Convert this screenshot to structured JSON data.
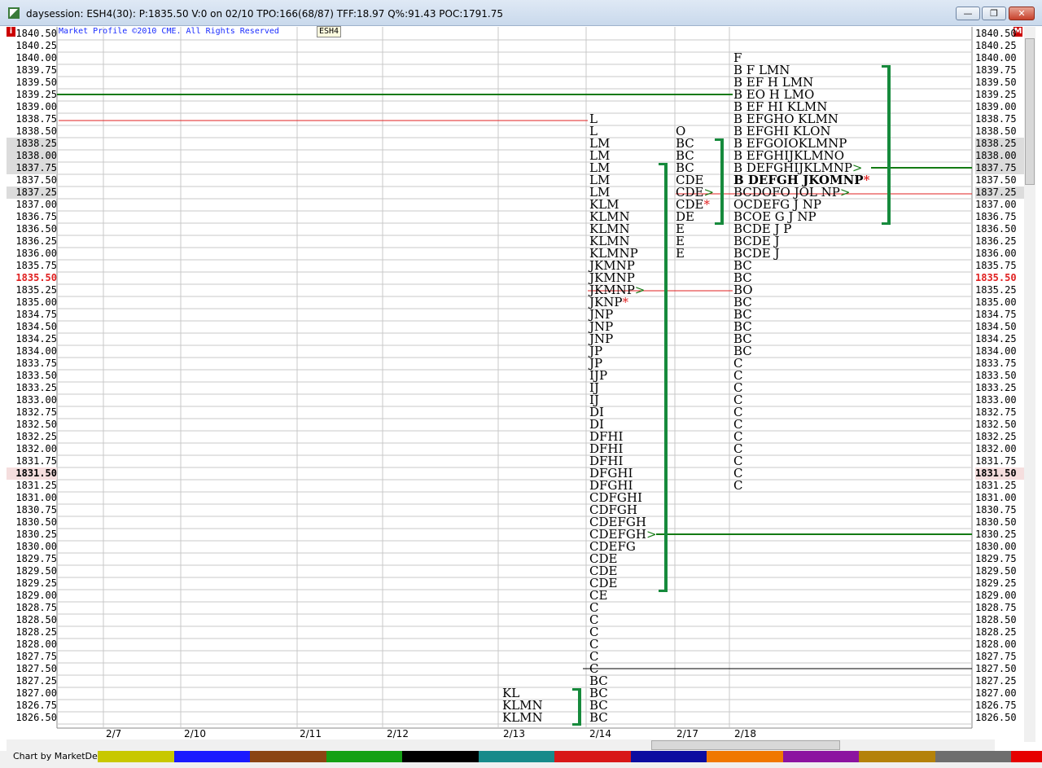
{
  "window": {
    "title": "daysession: ESH4(30): P:1835.50 V:0 on 02/10 TPO:166(68/87) TFF:18.97 Q%:91.43 POC:1791.75",
    "minimize": "—",
    "restore": "❐",
    "close": "✕"
  },
  "header": {
    "copyright": "Market Profile ©2010 CME. All Rights Reserved",
    "symbol": "ESH4",
    "left_corner": "i",
    "right_corner": "M"
  },
  "price_axis": [
    "1840.50",
    "1840.25",
    "1840.00",
    "1839.75",
    "1839.50",
    "1839.25",
    "1839.00",
    "1838.75",
    "1838.50",
    "1838.25",
    "1838.00",
    "1837.75",
    "1837.50",
    "1837.25",
    "1837.00",
    "1836.75",
    "1836.50",
    "1836.25",
    "1836.00",
    "1835.75",
    "1835.50",
    "1835.25",
    "1835.00",
    "1834.75",
    "1834.50",
    "1834.25",
    "1834.00",
    "1833.75",
    "1833.50",
    "1833.25",
    "1833.00",
    "1832.75",
    "1832.50",
    "1832.25",
    "1832.00",
    "1831.75",
    "1831.50",
    "1831.25",
    "1831.00",
    "1830.75",
    "1830.50",
    "1830.25",
    "1830.00",
    "1829.75",
    "1829.50",
    "1829.25",
    "1829.00",
    "1828.75",
    "1828.50",
    "1828.25",
    "1828.00",
    "1827.75",
    "1827.50",
    "1827.25",
    "1827.00",
    "1826.75",
    "1826.50"
  ],
  "dates": [
    "2/7",
    "2/10",
    "2/11",
    "2/12",
    "2/13",
    "2/14",
    "2/17",
    "2/18"
  ],
  "profiles": {
    "p213": [
      "KL",
      "KLMN",
      "KLMN"
    ],
    "p214": [
      "L",
      "L",
      "LM",
      "LM",
      "LM",
      "LM",
      "LM",
      "KLM",
      "KLMN",
      "KLMN",
      "KLMN",
      "KLMNP",
      "JKMNP",
      "JKMNP",
      "JKMNP>",
      "JKNP*",
      "JNP",
      "JNP",
      "JNP",
      "JP",
      "JP",
      "IJP",
      "IJ",
      "IJ",
      "DI",
      "DI",
      "DFHI",
      "DFHI",
      "DFHI",
      "DFGHI",
      "DFGHI",
      "CDFGHI",
      "CDFGH",
      "CDEFGH",
      "CDEFGH>",
      "CDEFG",
      "CDE",
      "CDE",
      "CDE",
      "CE",
      "C",
      "C",
      "C",
      "C",
      "C",
      "C",
      "BC",
      "BC",
      "BC",
      "BC"
    ],
    "p217": [
      "O",
      "BC",
      "BC",
      "BC",
      "CDE",
      "CDE>",
      "CDE*",
      "DE",
      "E",
      "E",
      "E"
    ],
    "p218": [
      "F",
      "B F LMN",
      "B EF H LMN",
      "B EO H LMO",
      "B EF HI KLMN",
      "B EFGHO KLMN",
      "B EFGHI KLON",
      "B EFGOIOKLMNP",
      "B EFGHIJKLMNO",
      "B DEFGHIJKLMNP>",
      "B DEFGH JKOMNP*",
      "BCDOFO JOL NP>",
      "OCDEFG J NP",
      "BCOE G J NP",
      "BCDE J P",
      "BCDE J",
      "BCDE J",
      "BC",
      "BC",
      "BO",
      "BC",
      "BC",
      "BC",
      "BC",
      "BC",
      "C",
      "C",
      "C",
      "C",
      "C",
      "C",
      "C",
      "C",
      "C",
      "C",
      "C"
    ]
  },
  "status": {
    "label": "Chart by MarketDelta"
  },
  "colors": {
    "value_area_bar": "#168a3c",
    "poc_line": "#e02020",
    "green_line": "#137a13",
    "grid": "#c8c8c8",
    "swatches": [
      "#c8c800",
      "#1a1aff",
      "#8b4513",
      "#14a014",
      "#000000",
      "#178a8a",
      "#d81818",
      "#0c0ca0",
      "#f07800",
      "#8c14a0",
      "#b4820a",
      "#6e6e6e",
      "#e60000"
    ]
  }
}
